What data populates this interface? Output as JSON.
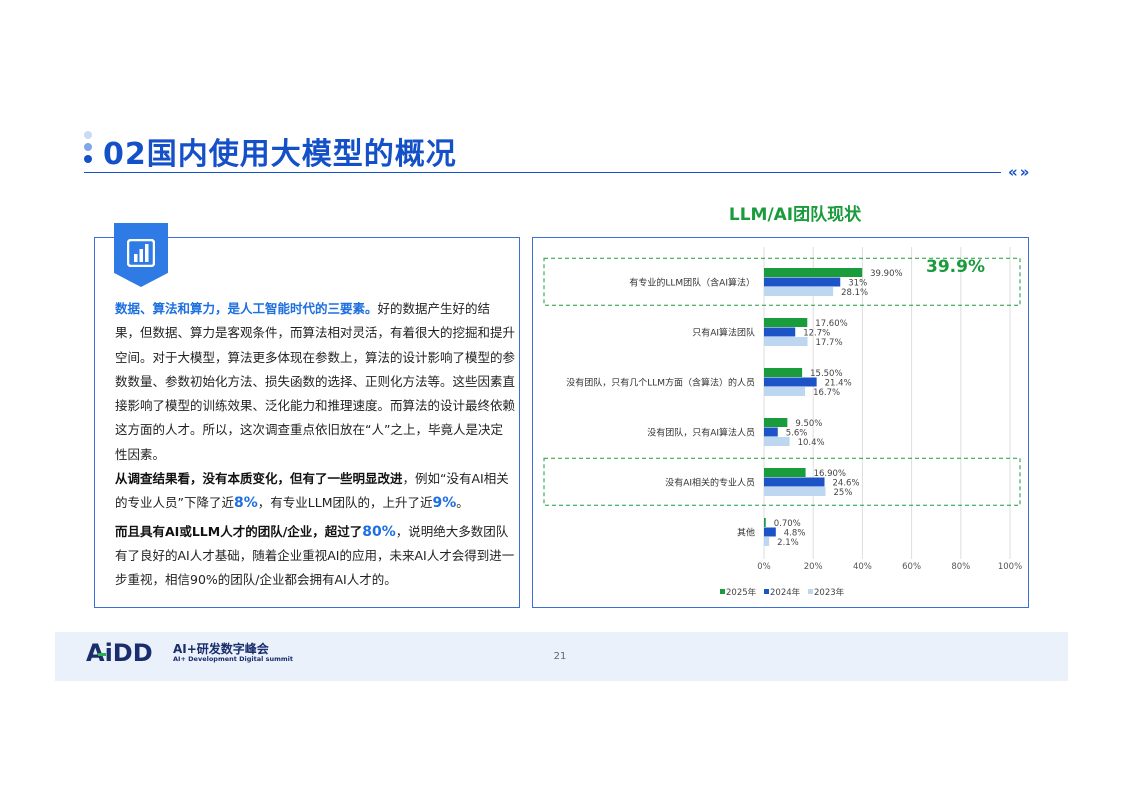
{
  "slide": {
    "title": "02国内使用大模型的概况",
    "chart_heading": "LLM/AI团队现状",
    "page_number": "21"
  },
  "text_panel": {
    "p1_bold": "数据、算法和算力，是人工智能时代的三要素。",
    "p1_rest": "好的数据产生好的结果，但数据、算力是客观条件，而算法相对灵活，有着很大的挖掘和提升空间。对于大模型，算法更多体现在参数上，算法的设计影响了模型的参数数量、参数初始化方法、损失函数的选择、正则化方法等。这些因素直接影响了模型的训练效果、泛化能力和推理速度。而算法的设计最终依赖这方面的人才。所以，这次调查重点依旧放在“人”之上，毕竟人是决定性因素。",
    "p2_bold": "从调查结果看，没有本质变化，但有了一些明显改进",
    "p2_a": "，例如“没有AI相关的专业人员”下降了近",
    "p2_v1": "8%",
    "p2_b": "，有专业LLM团队的，上升了近",
    "p2_v2": "9%",
    "p2_c": "。",
    "p3_bold": "而且具有AI或LLM人才的团队/企业，超过了",
    "p3_v": "80%",
    "p3_rest": "，说明绝大多数团队有了良好的AI人才基础，随着企业重视AI的应用，未来AI人才会得到进一步重视，相信90%的团队/企业都会拥有AI人才的。"
  },
  "footer": {
    "logo_text": "AiDD",
    "logo_cn": "AI+研发数字峰会",
    "logo_en": "AI+ Development Digital summit"
  },
  "colors": {
    "primary_blue": "#1450c8",
    "series_2025": "#1a9b3c",
    "series_2024": "#1c54c8",
    "series_2023": "#bcd7ef",
    "callout_green": "#1a9b3c"
  },
  "chart_data": {
    "type": "bar",
    "orientation": "horizontal",
    "categories": [
      "有专业的LLM团队（含AI算法）",
      "只有AI算法团队",
      "没有团队，只有几个LLM方面（含算法）的人员",
      "没有团队，只有AI算法人员",
      "没有AI相关的专业人员",
      "其他"
    ],
    "series": [
      {
        "name": "2025年",
        "values": [
          39.9,
          17.6,
          15.5,
          9.5,
          16.9,
          0.7
        ],
        "labels": [
          "39.90%",
          "17.60%",
          "15.50%",
          "9.50%",
          "16.90%",
          "0.70%"
        ]
      },
      {
        "name": "2024年",
        "values": [
          31,
          12.7,
          21.4,
          5.6,
          24.6,
          4.8
        ],
        "labels": [
          "31%",
          "12.7%",
          "21.4%",
          "5.6%",
          "24.6%",
          "4.8%"
        ]
      },
      {
        "name": "2023年",
        "values": [
          28.1,
          17.7,
          16.7,
          10.4,
          25,
          2.1
        ],
        "labels": [
          "28.1%",
          "17.7%",
          "16.7%",
          "10.4%",
          "25%",
          "2.1%"
        ]
      }
    ],
    "xlim": [
      0,
      100
    ],
    "xticks": [
      "0%",
      "20%",
      "40%",
      "60%",
      "80%",
      "100%"
    ],
    "grid": true,
    "legend_position": "bottom",
    "highlighted_categories": [
      0,
      4
    ],
    "callout": "39.9%"
  }
}
